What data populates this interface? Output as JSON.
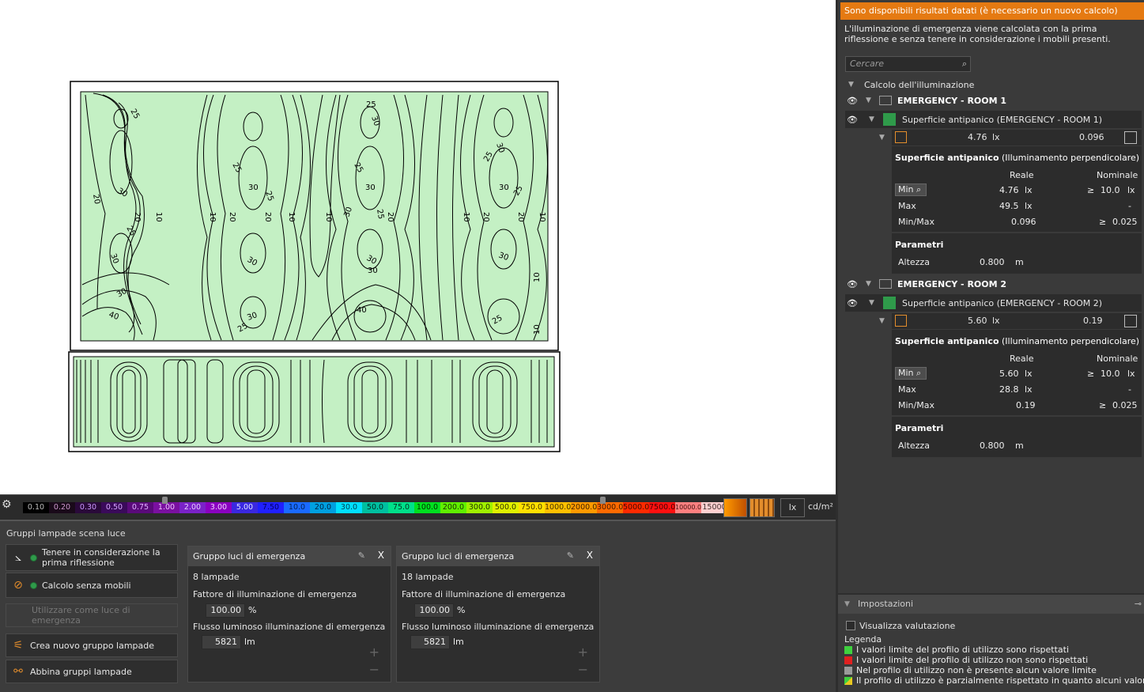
{
  "viewport": {
    "room1_labels": [
      "25",
      "30",
      "20",
      "10",
      "25",
      "30",
      "20",
      "10",
      "30",
      "20",
      "25",
      "30",
      "10",
      "20",
      "25",
      "30",
      "40",
      "30",
      "20",
      "10",
      "25",
      "30",
      "40",
      "30"
    ],
    "room_fill_color": "#c4f0c4"
  },
  "scale": {
    "settings_icon": "gear-icon",
    "steps": [
      {
        "label": "0.10",
        "bg": "#000000",
        "fg": "#bbbbbb"
      },
      {
        "label": "0.20",
        "bg": "#1a0a1a",
        "fg": "#cc99cc"
      },
      {
        "label": "0.30",
        "bg": "#2a0a3a",
        "fg": "#cc99ff"
      },
      {
        "label": "0.50",
        "bg": "#3a0a5a",
        "fg": "#d7a6ff"
      },
      {
        "label": "0.75",
        "bg": "#5a0a7a",
        "fg": "#e0b0ff"
      },
      {
        "label": "1.00",
        "bg": "#7a10a0",
        "fg": "#f0c0ff"
      },
      {
        "label": "2.00",
        "bg": "#7a22c8",
        "fg": "#e6ccff"
      },
      {
        "label": "3.00",
        "bg": "#8a00c0",
        "fg": "#f2d0ff"
      },
      {
        "label": "5.00",
        "bg": "#3a28e0",
        "fg": "#dde0ff"
      },
      {
        "label": "7.50",
        "bg": "#2020ff",
        "fg": "#000060"
      },
      {
        "label": "10.0",
        "bg": "#1a6aff",
        "fg": "#002255"
      },
      {
        "label": "20.0",
        "bg": "#00a0e0",
        "fg": "#002244"
      },
      {
        "label": "30.0",
        "bg": "#00e0ff",
        "fg": "#004455"
      },
      {
        "label": "50.0",
        "bg": "#00c0a0",
        "fg": "#002a22"
      },
      {
        "label": "75.0",
        "bg": "#00e08a",
        "fg": "#003322"
      },
      {
        "label": "100.0",
        "bg": "#00e020",
        "fg": "#003300"
      },
      {
        "label": "200.0",
        "bg": "#60f000",
        "fg": "#1a3300"
      },
      {
        "label": "300.0",
        "bg": "#a0f000",
        "fg": "#223300"
      },
      {
        "label": "500.0",
        "bg": "#e0f000",
        "fg": "#333300"
      },
      {
        "label": "750.0",
        "bg": "#ffe000",
        "fg": "#443300"
      },
      {
        "label": "1000.0",
        "bg": "#ffc000",
        "fg": "#443300"
      },
      {
        "label": "2000.0",
        "bg": "#ff9a00",
        "fg": "#442200"
      },
      {
        "label": "3000.0",
        "bg": "#ff6a00",
        "fg": "#441a00"
      },
      {
        "label": "5000.0",
        "bg": "#ff2a00",
        "fg": "#440a00"
      },
      {
        "label": "7500.0",
        "bg": "#ff1010",
        "fg": "#440000"
      },
      {
        "label": "10000.0",
        "bg": "#ff8080",
        "fg": "#441111"
      },
      {
        "label": "15000",
        "bg": "#ffd0d0",
        "fg": "#443333"
      }
    ],
    "unit_lx": "lx",
    "unit_cd": "cd/m²"
  },
  "bottom": {
    "title": "Gruppi lampade scena luce",
    "buttons": [
      {
        "label": "Tenere in considerazione la prima riflessione",
        "icon": "reflection-icon"
      },
      {
        "label": "Calcolo senza mobili",
        "icon": "no-furniture-icon"
      },
      {
        "label": "Utilizzare come luce di emergenza",
        "icon": ""
      },
      {
        "label": "Crea nuovo gruppo lampade",
        "icon": "lamp-group-icon"
      },
      {
        "label": "Abbina gruppi lampade",
        "icon": "match-groups-icon"
      }
    ],
    "groups": [
      {
        "title": "Gruppo luci di emergenza",
        "count": "8 lampade",
        "factor_label": "Fattore di illuminazione di emergenza",
        "factor": "100.00",
        "factor_unit": "%",
        "flux_label": "Flusso luminoso illuminazione di emergenza",
        "flux": "5821",
        "flux_unit": "lm"
      },
      {
        "title": "Gruppo luci di emergenza",
        "count": "18 lampade",
        "factor_label": "Fattore di illuminazione di emergenza",
        "factor": "100.00",
        "factor_unit": "%",
        "flux_label": "Flusso luminoso illuminazione di emergenza",
        "flux": "5821",
        "flux_unit": "lm"
      }
    ],
    "close_label": "X"
  },
  "right": {
    "warning": "Sono disponibili risultati datati (è necessario un nuovo calcolo)",
    "info": "L'illuminazione di emergenza viene calcolata con la prima riflessione e senza tenere in considerazione i mobili presenti.",
    "search_placeholder": "Cercare",
    "tree_root": "Calcolo dell'illuminazione",
    "rooms": [
      {
        "name": "EMERGENCY - ROOM 1",
        "surface": "Superficie antipanico (EMERGENCY - ROOM 1)",
        "summary_val": "4.76",
        "summary_unit": "lx",
        "summary_ratio": "0.096",
        "card_title_bold": "Superficie antipanico",
        "card_title_rest": "(Illuminamento perpendicolare)",
        "col_real": "Reale",
        "col_nominal": "Nominale",
        "rows": [
          {
            "label": "Min",
            "real": "4.76",
            "real_unit": "lx",
            "ge": "≥",
            "nom": "10.0",
            "nom_unit": "lx"
          },
          {
            "label": "Max",
            "real": "49.5",
            "real_unit": "lx",
            "ge": "",
            "nom": "-",
            "nom_unit": ""
          },
          {
            "label": "Min/Max",
            "real": "0.096",
            "real_unit": "",
            "ge": "≥",
            "nom": "0.025",
            "nom_unit": ""
          }
        ],
        "params_title": "Parametri",
        "height_label": "Altezza",
        "height_val": "0.800",
        "height_unit": "m"
      },
      {
        "name": "EMERGENCY - ROOM 2",
        "surface": "Superficie antipanico (EMERGENCY - ROOM 2)",
        "summary_val": "5.60",
        "summary_unit": "lx",
        "summary_ratio": "0.19",
        "card_title_bold": "Superficie antipanico",
        "card_title_rest": "(Illuminamento perpendicolare)",
        "col_real": "Reale",
        "col_nominal": "Nominale",
        "rows": [
          {
            "label": "Min",
            "real": "5.60",
            "real_unit": "lx",
            "ge": "≥",
            "nom": "10.0",
            "nom_unit": "lx"
          },
          {
            "label": "Max",
            "real": "28.8",
            "real_unit": "lx",
            "ge": "",
            "nom": "-",
            "nom_unit": ""
          },
          {
            "label": "Min/Max",
            "real": "0.19",
            "real_unit": "",
            "ge": "≥",
            "nom": "0.025",
            "nom_unit": ""
          }
        ],
        "params_title": "Parametri",
        "height_label": "Altezza",
        "height_val": "0.800",
        "height_unit": "m"
      }
    ],
    "settings": {
      "title": "Impostazioni",
      "show_eval": "Visualizza valutazione",
      "legend_title": "Legenda",
      "legend": [
        {
          "color": "#3fd13f",
          "text": "I valori limite del profilo di utilizzo sono rispettati"
        },
        {
          "color": "#e02020",
          "text": "I valori limite del profilo di utilizzo non sono rispettati"
        },
        {
          "color": "#9a9a9a",
          "text": "Nel profilo di utilizzo non è presente alcun valore limite"
        },
        {
          "color": "#8ccf3a",
          "text": "Il profilo di utilizzo è parzialmente rispettato in quanto alcuni valori limite s"
        }
      ]
    }
  }
}
